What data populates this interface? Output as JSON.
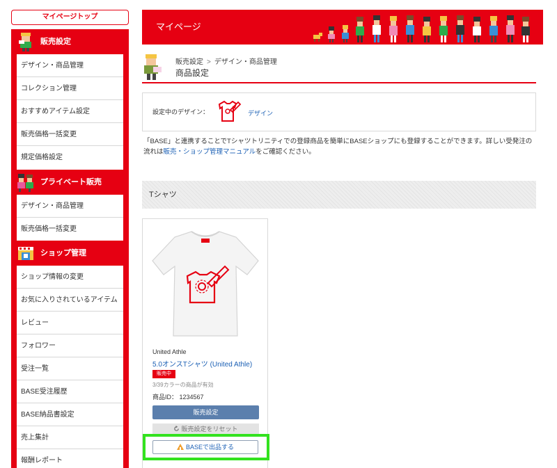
{
  "sidebar": {
    "top_button": "マイページトップ",
    "sections": [
      {
        "title": "販売設定",
        "items": [
          "デザイン・商品管理",
          "コレクション管理",
          "おすすめアイテム設定",
          "販売価格一括変更",
          "規定価格設定"
        ]
      },
      {
        "title": "プライベート販売",
        "items": [
          "デザイン・商品管理",
          "販売価格一括変更"
        ]
      },
      {
        "title": "ショップ管理",
        "items": [
          "ショップ情報の変更",
          "お気に入りされているアイテム",
          "レビュー",
          "フォロワー",
          "受注一覧",
          "BASE受注履歴",
          "BASE納品書設定",
          "売上集計",
          "報酬レポート"
        ]
      }
    ]
  },
  "banner": {
    "title": "マイページ"
  },
  "breadcrumb": {
    "level1": "販売設定",
    "separator": ">",
    "level2": "デザイン・商品管理"
  },
  "page": {
    "title": "商品設定"
  },
  "design": {
    "label": "設定中のデザイン：",
    "link": "デザイン"
  },
  "info": {
    "text_before": "「BASE」と連携することでTシャツトリニティでの登録商品を簡単にBASEショップにも登録することができます。詳しい受発注の流れは",
    "link": "販売・ショップ管理マニュアル",
    "text_after": "をご確認ください。"
  },
  "section": {
    "title": "Tシャツ"
  },
  "product": {
    "brand": "United Athle",
    "name": "5.0オンスTシャツ (United Athle)",
    "status": "販売中",
    "colors": "3/39カラーの商品が有効",
    "id": "商品ID： 1234567",
    "settings_button": "販売設定",
    "reset_button": "販売設定をリセット",
    "base_button": "BASEで出品する"
  },
  "colors": {
    "accent": "#e60012",
    "link": "#1a5fb4",
    "button": "#5b7fad",
    "highlight": "#33e21f"
  },
  "icons": [
    "seller-character-icon",
    "private-character-icon",
    "shop-icon",
    "design-tshirt-icon",
    "reset-icon",
    "base-icon"
  ]
}
